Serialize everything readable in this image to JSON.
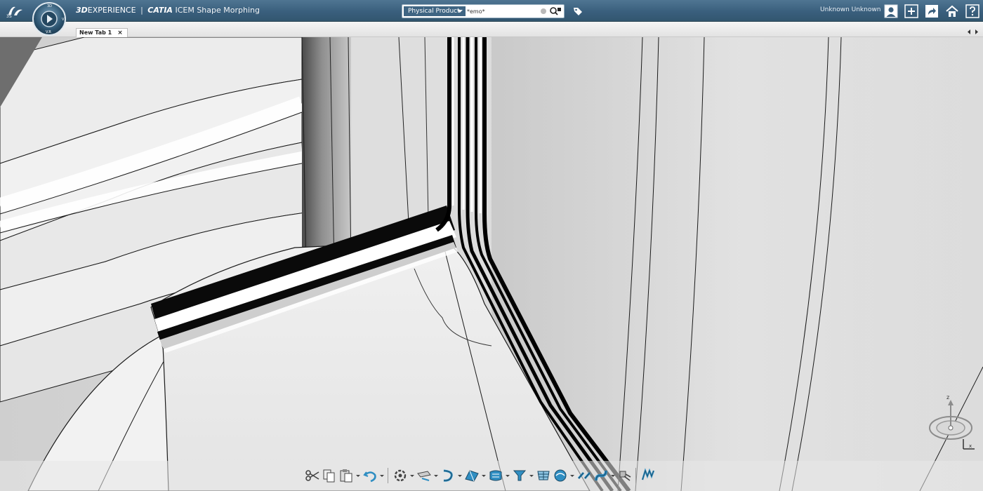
{
  "header": {
    "brand_3d": "3D",
    "brand_experience": "EXPERIENCE",
    "brand_separator": "|",
    "brand_catia": "CATIA",
    "brand_app": "ICEM Shape Morphing",
    "compass_labels": {
      "top": "3D",
      "right": "V",
      "bottom": "V.R"
    },
    "search": {
      "scope": "Physical Product",
      "query": "*emo*"
    },
    "user_name": "Unknown Unknown"
  },
  "tabs": [
    {
      "label": "New Tab 1",
      "close": "×"
    }
  ],
  "compass3d": {
    "axis_z": "z",
    "axis_x": "x"
  },
  "icons": {
    "header": [
      "3ds-logo-icon",
      "compass-icon",
      "search-icon",
      "tag-icon",
      "user-icon",
      "add-icon",
      "share-icon",
      "home-icon",
      "help-icon"
    ],
    "toolbar": [
      "cut-icon",
      "copy-icon",
      "paste-icon",
      "undo-icon",
      "update-icon",
      "measure-icon",
      "curve-icon",
      "surface-icon",
      "morph-icon",
      "filter-icon",
      "analysis-icon",
      "surface-analysis-icon",
      "connect-icon",
      "blend-icon",
      "sweep-icon",
      "icem-icon"
    ]
  },
  "colors": {
    "header": "#3a5f7d",
    "accent": "#2f8ec2",
    "scope": "#3f6583"
  }
}
